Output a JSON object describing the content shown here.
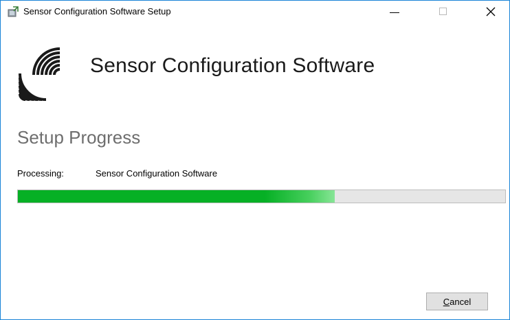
{
  "window": {
    "title": "Sensor Configuration Software Setup",
    "icon": "installer-icon",
    "controls": {
      "minimize_icon": "minimize-icon",
      "maximize_icon": "maximize-icon",
      "close_glyph": "✕"
    }
  },
  "banner": {
    "logo_icon": "sensor-waves-logo",
    "product_name": "Sensor Configuration Software"
  },
  "main": {
    "heading": "Setup Progress",
    "status_label": "Processing:",
    "status_value": "Sensor Configuration Software",
    "progress_fraction": 0.65
  },
  "footer": {
    "cancel_mnemonic": "C",
    "cancel_rest": "ancel"
  },
  "colors": {
    "accent_border": "#1883d7",
    "progress_green": "#06b025",
    "heading_gray": "#6e6e6e"
  }
}
